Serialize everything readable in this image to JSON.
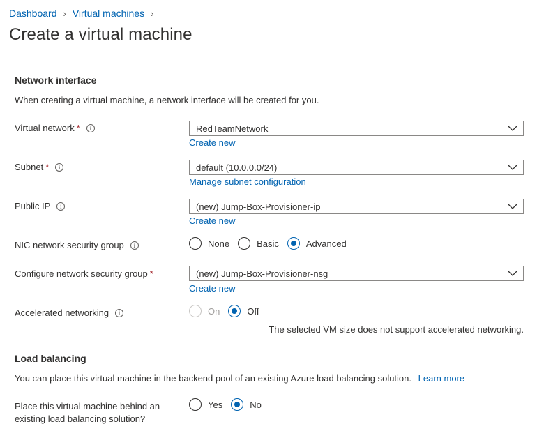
{
  "breadcrumb": {
    "items": [
      "Dashboard",
      "Virtual machines"
    ]
  },
  "page_title": "Create a virtual machine",
  "network_interface": {
    "title": "Network interface",
    "description": "When creating a virtual machine, a network interface will be created for you.",
    "virtual_network": {
      "label": "Virtual network",
      "value": "RedTeamNetwork",
      "link": "Create new"
    },
    "subnet": {
      "label": "Subnet",
      "value": "default (10.0.0.0/24)",
      "link": "Manage subnet configuration"
    },
    "public_ip": {
      "label": "Public IP",
      "value": "(new) Jump-Box-Provisioner-ip",
      "link": "Create new"
    },
    "nic_nsg": {
      "label": "NIC network security group",
      "options": [
        "None",
        "Basic",
        "Advanced"
      ],
      "selected": "Advanced"
    },
    "configure_nsg": {
      "label": "Configure network security group",
      "value": "(new) Jump-Box-Provisioner-nsg",
      "link": "Create new"
    },
    "accelerated": {
      "label": "Accelerated networking",
      "options": [
        "On",
        "Off"
      ],
      "selected": "Off",
      "note": "The selected VM size does not support accelerated networking."
    }
  },
  "load_balancing": {
    "title": "Load balancing",
    "description": "You can place this virtual machine in the backend pool of an existing Azure load balancing solution.",
    "learn_more": "Learn more",
    "place_behind": {
      "label_line1": "Place this virtual machine behind an",
      "label_line2": "existing load balancing solution?",
      "options": [
        "Yes",
        "No"
      ],
      "selected": "No"
    }
  },
  "required_marker": "*",
  "info_glyph": "i",
  "colors": {
    "link": "#0063b1",
    "required": "#a4262c",
    "text": "#323130"
  }
}
